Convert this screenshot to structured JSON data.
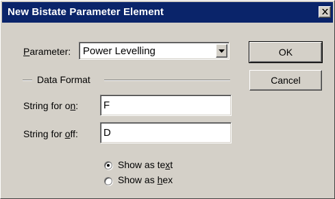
{
  "window": {
    "title": "New Bistate Parameter Element",
    "close_icon": "close-x-icon"
  },
  "parameter": {
    "label_pre": "",
    "label_access": "P",
    "label_post": "arameter:",
    "selected": "Power Levelling",
    "dropdown_icon": "chevron-down-icon"
  },
  "group": {
    "title": "Data Format"
  },
  "string_on": {
    "label_pre": "String for o",
    "label_access": "n",
    "label_post": ":",
    "value": "F"
  },
  "string_off": {
    "label_pre": "String for ",
    "label_access": "o",
    "label_post": "ff:",
    "value": "D"
  },
  "show_format": {
    "options": [
      {
        "pre": "Show as te",
        "access": "x",
        "post": "t",
        "selected": true
      },
      {
        "pre": "Show as ",
        "access": "h",
        "post": "ex",
        "selected": false
      }
    ]
  },
  "buttons": {
    "ok": "OK",
    "cancel": "Cancel"
  }
}
